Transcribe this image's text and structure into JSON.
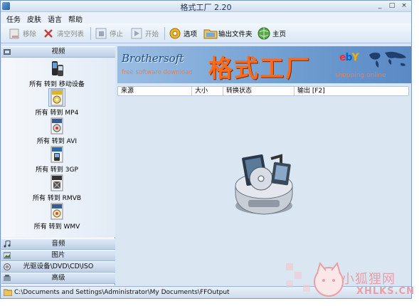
{
  "window": {
    "title": "格式工厂 2.20",
    "minimize": "_",
    "maximize": "□",
    "close": "×"
  },
  "menu": {
    "items": [
      "任务",
      "皮肤",
      "语言",
      "帮助"
    ]
  },
  "toolbar": {
    "remove": "移除",
    "clear_list": "清空列表",
    "stop": "停止",
    "start": "开始",
    "options": "选项",
    "output_folder": "输出文件夹",
    "homepage": "主页"
  },
  "sidebar": {
    "video_header": "视频",
    "video_items": [
      "所有 转到 移动设备",
      "所有 转到 MP4",
      "所有 转到 AVI",
      "所有 转到 3GP",
      "所有 转到 RMVB",
      "所有 转到 WMV"
    ],
    "audio_header": "音频",
    "picture_header": "图片",
    "rom_header": "光驱设备\\DVD\\CD\\ISO",
    "advanced_header": "高级"
  },
  "banner": {
    "brothersoft": "Brothersoft",
    "brothersoft_sub": "free software download",
    "title": "格式工厂",
    "ebay": "ebY",
    "ebay_sub": "shopping online"
  },
  "table": {
    "columns": [
      "来源",
      "大小",
      "转换状态",
      "输出 [F2]"
    ]
  },
  "status": {
    "path": "C:\\Documents and Settings\\Administrator\\My Documents\\FFOutput"
  },
  "watermark": {
    "text": "小狐狸网",
    "sub": "XHLKS.CN"
  },
  "colors": {
    "accent": "#ff6a1a",
    "window_bg": "#d8e6f5",
    "banner_blue": "#6f9dd0"
  }
}
